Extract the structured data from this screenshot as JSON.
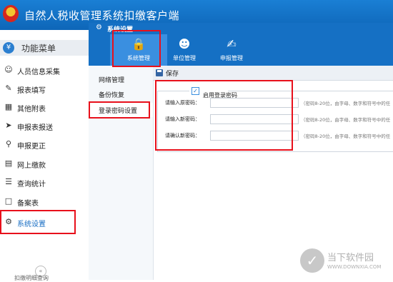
{
  "app": {
    "title": "自然人税收管理系统扣缴客户端"
  },
  "sidebar": {
    "header_label": "功能菜单",
    "header_icon": "yen-icon",
    "items": [
      {
        "label": "人员信息采集",
        "icon": "person-icon"
      },
      {
        "label": "报表填写",
        "icon": "edit-icon"
      },
      {
        "label": "其他附表",
        "icon": "grid-icon"
      },
      {
        "label": "申报表报送",
        "icon": "send-icon"
      },
      {
        "label": "申报更正",
        "icon": "search-icon"
      },
      {
        "label": "网上缴款",
        "icon": "wallet-icon"
      },
      {
        "label": "查询统计",
        "icon": "chart-icon"
      },
      {
        "label": "备案表",
        "icon": "document-icon"
      },
      {
        "label": "系统设置",
        "icon": "gear-icon"
      }
    ],
    "collapse_label": "«",
    "bottom_peek": "扣缴明细查询"
  },
  "dialog": {
    "title": "系统设置",
    "tabs": [
      {
        "label": "系统管理",
        "icon": "lock-icon"
      },
      {
        "label": "单位管理",
        "icon": "people-icon"
      },
      {
        "label": "申报管理",
        "icon": "report-icon"
      }
    ],
    "subnav": [
      {
        "label": "网络管理"
      },
      {
        "label": "备份恢复"
      },
      {
        "label": "登录密码设置"
      }
    ],
    "toolbar": {
      "save_label": "保存"
    },
    "login_password": {
      "enable_label": "启用登录密码",
      "enabled": true,
      "fields": [
        {
          "label": "请输入原密码：",
          "value": "",
          "hint": "（密码8-20位，由字母、数字和符号中的任"
        },
        {
          "label": "请输入新密码：",
          "value": "",
          "hint": "（密码8-20位，由字母、数字和符号中的任"
        },
        {
          "label": "请确认新密码：",
          "value": "",
          "hint": "（密码8-20位，由字母、数字和符号中的任"
        }
      ]
    }
  },
  "watermark": {
    "cn": "当下软件园",
    "en": "WWW.DOWNXIA.COM"
  },
  "colors": {
    "accent": "#1570c4",
    "highlight": "#e8101b"
  }
}
